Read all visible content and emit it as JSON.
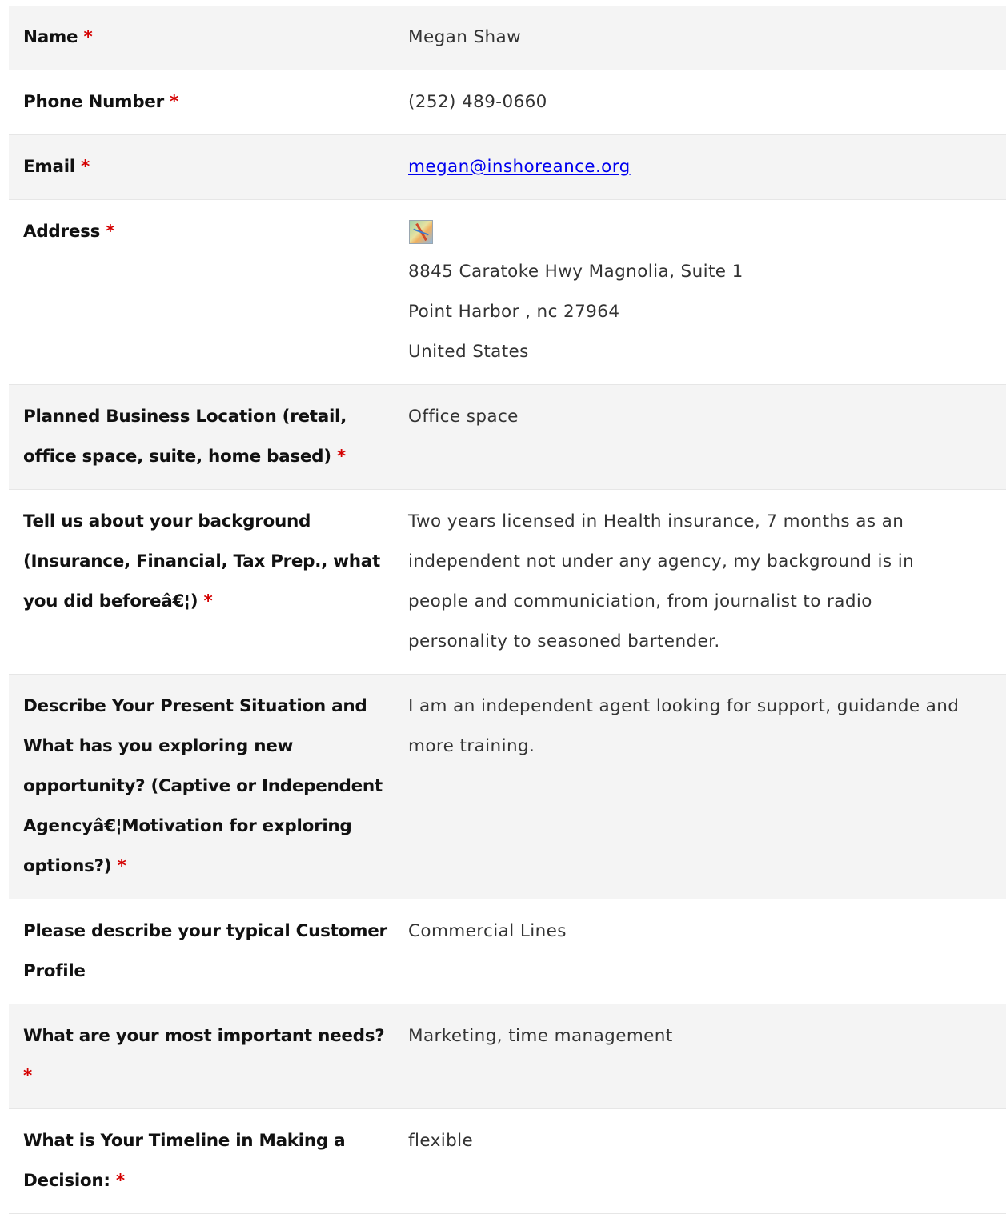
{
  "rows": [
    {
      "label": "Name",
      "required": "*",
      "value": "Megan Shaw"
    },
    {
      "label": "Phone Number",
      "required": "*",
      "value": "(252) 489-0660"
    },
    {
      "label": "Email",
      "required": "*",
      "value": "megan@inshoreance.org"
    },
    {
      "label": "Address",
      "required": "*",
      "map_icon": "map-thumbnail-icon",
      "lines": [
        "8845 Caratoke Hwy Magnolia, Suite 1",
        "Point Harbor , nc 27964",
        "United States"
      ]
    },
    {
      "label": "Planned Business Location (retail, office space, suite, home based)",
      "required": "*",
      "value": "Office space"
    },
    {
      "label": "Tell us about your background (Insurance, Financial, Tax Prep., what you did beforeâ€¦)",
      "required": "*",
      "value": "Two years licensed in Health insurance, 7 months as an independent not under any agency, my background is in people and communiciation, from journalist to radio personality to seasoned bartender."
    },
    {
      "label": "Describe Your Present Situation and What has you exploring new opportunity? (Captive or Independent Agencyâ€¦Motivation for exploring options?)",
      "required": "*",
      "value": "I am an independent agent looking for support, guidande and more training."
    },
    {
      "label": "Please describe your typical Customer Profile",
      "required": "",
      "value": "Commercial Lines"
    },
    {
      "label": "What are your most important needs?",
      "required": "*",
      "value": "Marketing, time management"
    },
    {
      "label": "What is Your Timeline in Making a Decision:",
      "required": "*",
      "value": "flexible"
    }
  ],
  "colors": {
    "shaded_row": "#f4f4f4",
    "required_marker": "#d40000",
    "link": "#0000ee"
  }
}
